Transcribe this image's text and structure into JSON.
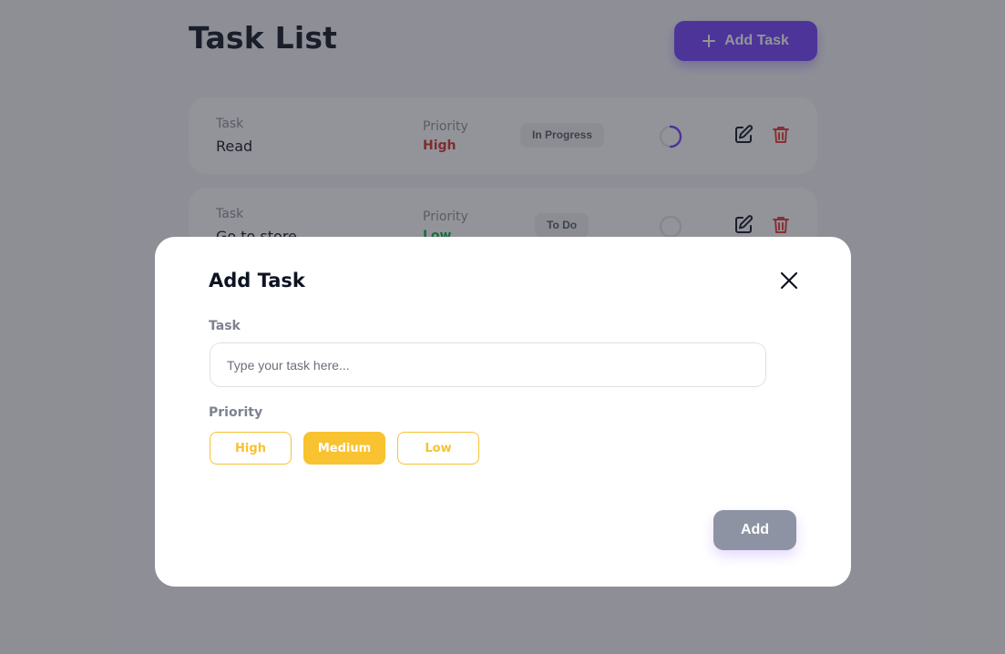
{
  "header": {
    "title": "Task List",
    "add_button_label": "Add Task"
  },
  "tasks": [
    {
      "task_label": "Task",
      "task": "Read",
      "priority_label": "Priority",
      "priority": "High",
      "priority_color": "#d32f2f",
      "status": "In Progress",
      "progress_icon": "half-progress-ring-icon",
      "progress_fraction": 0.5
    },
    {
      "task_label": "Task",
      "task": "Go to store",
      "priority_label": "Priority",
      "priority": "Low",
      "priority_color": "#0fae46",
      "status": "To Do",
      "progress_icon": "empty-progress-ring-icon",
      "progress_fraction": 0
    }
  ],
  "modal": {
    "title": "Add Task",
    "task_label": "Task",
    "task_placeholder": "Type your task here...",
    "task_value": "",
    "priority_label": "Priority",
    "priority_options": [
      "High",
      "Medium",
      "Low"
    ],
    "selected_priority": "Medium",
    "submit_label": "Add"
  },
  "colors": {
    "accent": "#713fff",
    "priority_selected": "#f8c230",
    "overlay": "#272a33",
    "submit_disabled": "#8d93a2"
  }
}
